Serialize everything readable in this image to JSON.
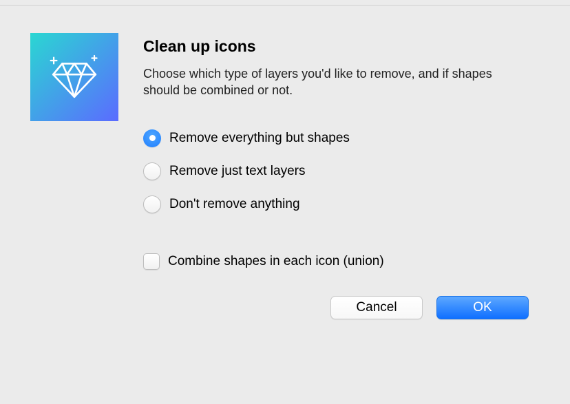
{
  "title": "Clean up icons",
  "description": "Choose which type of layers you'd like to remove, and if shapes should be combined or not.",
  "options": {
    "selectedIndex": 0,
    "items": [
      {
        "label": "Remove everything but shapes"
      },
      {
        "label": "Remove just text layers"
      },
      {
        "label": "Don't remove anything"
      }
    ]
  },
  "checkbox": {
    "label": "Combine shapes in each icon (union)",
    "checked": false
  },
  "buttons": {
    "cancel": "Cancel",
    "ok": "OK"
  }
}
